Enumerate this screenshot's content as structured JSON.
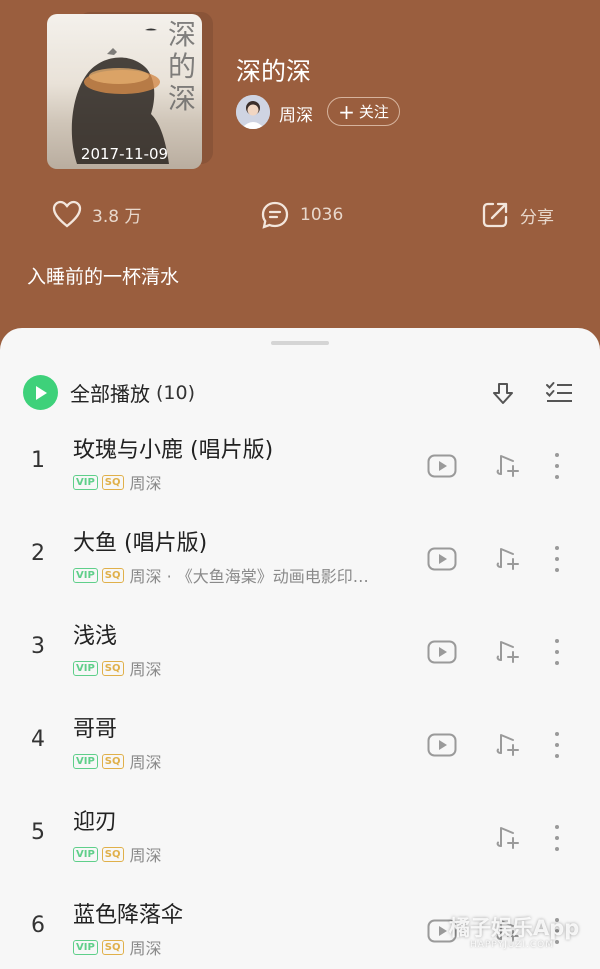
{
  "album": {
    "cover_date": "2017-11-09",
    "cover_text": "深的深",
    "title": "深的深",
    "artist": "周深",
    "follow_label": "关注",
    "follow_plus": "+",
    "likes": "3.8 万",
    "comments": "1036",
    "share_label": "分享",
    "description": "入睡前的一杯清水"
  },
  "playlist": {
    "play_all_label": "全部播放",
    "count": "(10)",
    "songs": [
      {
        "num": "1",
        "title": "玫瑰与小鹿 (唱片版)",
        "vip": "VIP",
        "sq": "SQ",
        "meta": "周深",
        "has_mv": true
      },
      {
        "num": "2",
        "title": "大鱼 (唱片版)",
        "vip": "VIP",
        "sq": "SQ",
        "meta": "周深 · 《大鱼海棠》动画电影印…",
        "has_mv": true
      },
      {
        "num": "3",
        "title": "浅浅",
        "vip": "VIP",
        "sq": "SQ",
        "meta": "周深",
        "has_mv": true
      },
      {
        "num": "4",
        "title": "哥哥",
        "vip": "VIP",
        "sq": "SQ",
        "meta": "周深",
        "has_mv": true
      },
      {
        "num": "5",
        "title": "迎刃",
        "vip": "VIP",
        "sq": "SQ",
        "meta": "周深",
        "has_mv": false
      },
      {
        "num": "6",
        "title": "蓝色降落伞",
        "vip": "VIP",
        "sq": "SQ",
        "meta": "周深",
        "has_mv": true
      }
    ]
  },
  "watermark": {
    "main": "橘子娱乐App",
    "sub": "HAPPYJUZI.COM"
  },
  "colors": {
    "header_bg": "#9a5e3e",
    "sheet_bg": "#f7f7f7",
    "accent_green": "#3ed17a",
    "vip": "#5fcf8a",
    "sq": "#e0b04a"
  },
  "icons": [
    "heart-icon",
    "comment-icon",
    "share-icon",
    "play-icon",
    "download-icon",
    "multiselect-icon",
    "mv-icon",
    "add-to-playlist-icon",
    "more-icon"
  ]
}
